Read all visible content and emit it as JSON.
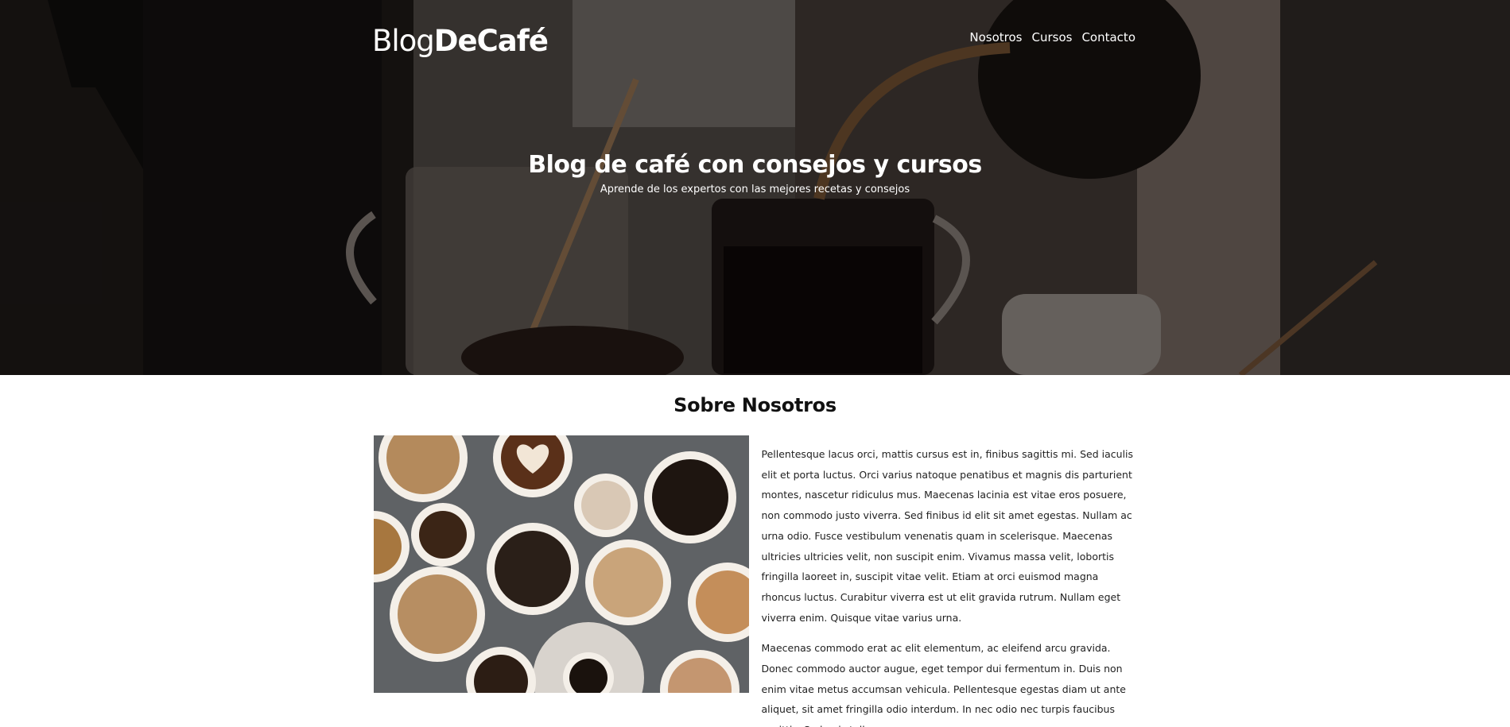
{
  "header": {
    "logo_light": "Blog",
    "logo_bold": "DeCafé",
    "nav": [
      "Nosotros",
      "Cursos",
      "Contacto"
    ]
  },
  "hero": {
    "title": "Blog de café con consejos y cursos",
    "subtitle": "Aprende de los expertos con las mejores recetas y consejos"
  },
  "about": {
    "title": "Sobre Nosotros",
    "paragraphs": [
      "Pellentesque lacus orci, mattis cursus est in, finibus sagittis mi. Sed iaculis elit et porta luctus. Orci varius natoque penatibus et magnis dis parturient montes, nascetur ridiculus mus. Maecenas lacinia est vitae eros posuere, non commodo justo viverra. Sed finibus id elit sit amet egestas. Nullam ac urna odio. Fusce vestibulum venenatis quam in scelerisque. Maecenas ultricies ultricies velit, non suscipit enim. Vivamus massa velit, lobortis fringilla laoreet in, suscipit vitae velit. Etiam at orci euismod magna rhoncus luctus. Curabitur viverra est ut elit gravida rutrum. Nullam eget viverra enim. Quisque vitae varius urna.",
      "Maecenas commodo erat ac elit elementum, ac eleifend arcu gravida. Donec commodo auctor augue, eget tempor dui fermentum in. Duis non enim vitae metus accumsan vehicula. Pellentesque egestas diam ut ante aliquet, sit amet fringilla odio interdum. In nec odio nec turpis faucibus sagittis. Sed quis tellus"
    ]
  }
}
